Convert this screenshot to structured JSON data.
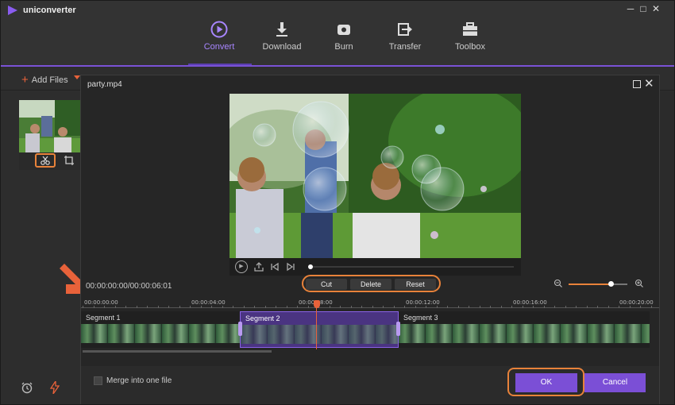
{
  "app": {
    "name": "uniconverter",
    "window_controls": [
      "─",
      "□",
      "✕"
    ]
  },
  "nav": {
    "tabs": [
      {
        "label": "Convert",
        "icon": "convert-icon",
        "active": true
      },
      {
        "label": "Download",
        "icon": "download-icon",
        "active": false
      },
      {
        "label": "Burn",
        "icon": "burn-icon",
        "active": false
      },
      {
        "label": "Transfer",
        "icon": "transfer-icon",
        "active": false
      },
      {
        "label": "Toolbox",
        "icon": "toolbox-icon",
        "active": false
      }
    ]
  },
  "toolbar": {
    "add_files_label": "Add Files"
  },
  "dialog": {
    "title": "party.mp4",
    "timecode": "00:00:00:00/00:00:06:01",
    "edit_buttons": {
      "cut": "Cut",
      "delete": "Delete",
      "reset": "Reset"
    },
    "zoom_level": 0.72,
    "ruler_labels": [
      "00:00:00:00",
      "00:00:04:00",
      "00:00:08:00",
      "00:00:12:00",
      "00:00:16:00",
      "00:00:20:00"
    ],
    "segments": [
      {
        "label": "Segment 1",
        "selected": false
      },
      {
        "label": "Segment 2",
        "selected": true
      },
      {
        "label": "Segment 3",
        "selected": false
      }
    ],
    "merge_label": "Merge into one file",
    "ok_label": "OK",
    "cancel_label": "Cancel"
  },
  "colors": {
    "accent_purple": "#7b4fd6",
    "highlight_orange": "#e8823a",
    "playhead": "#e8623a"
  }
}
